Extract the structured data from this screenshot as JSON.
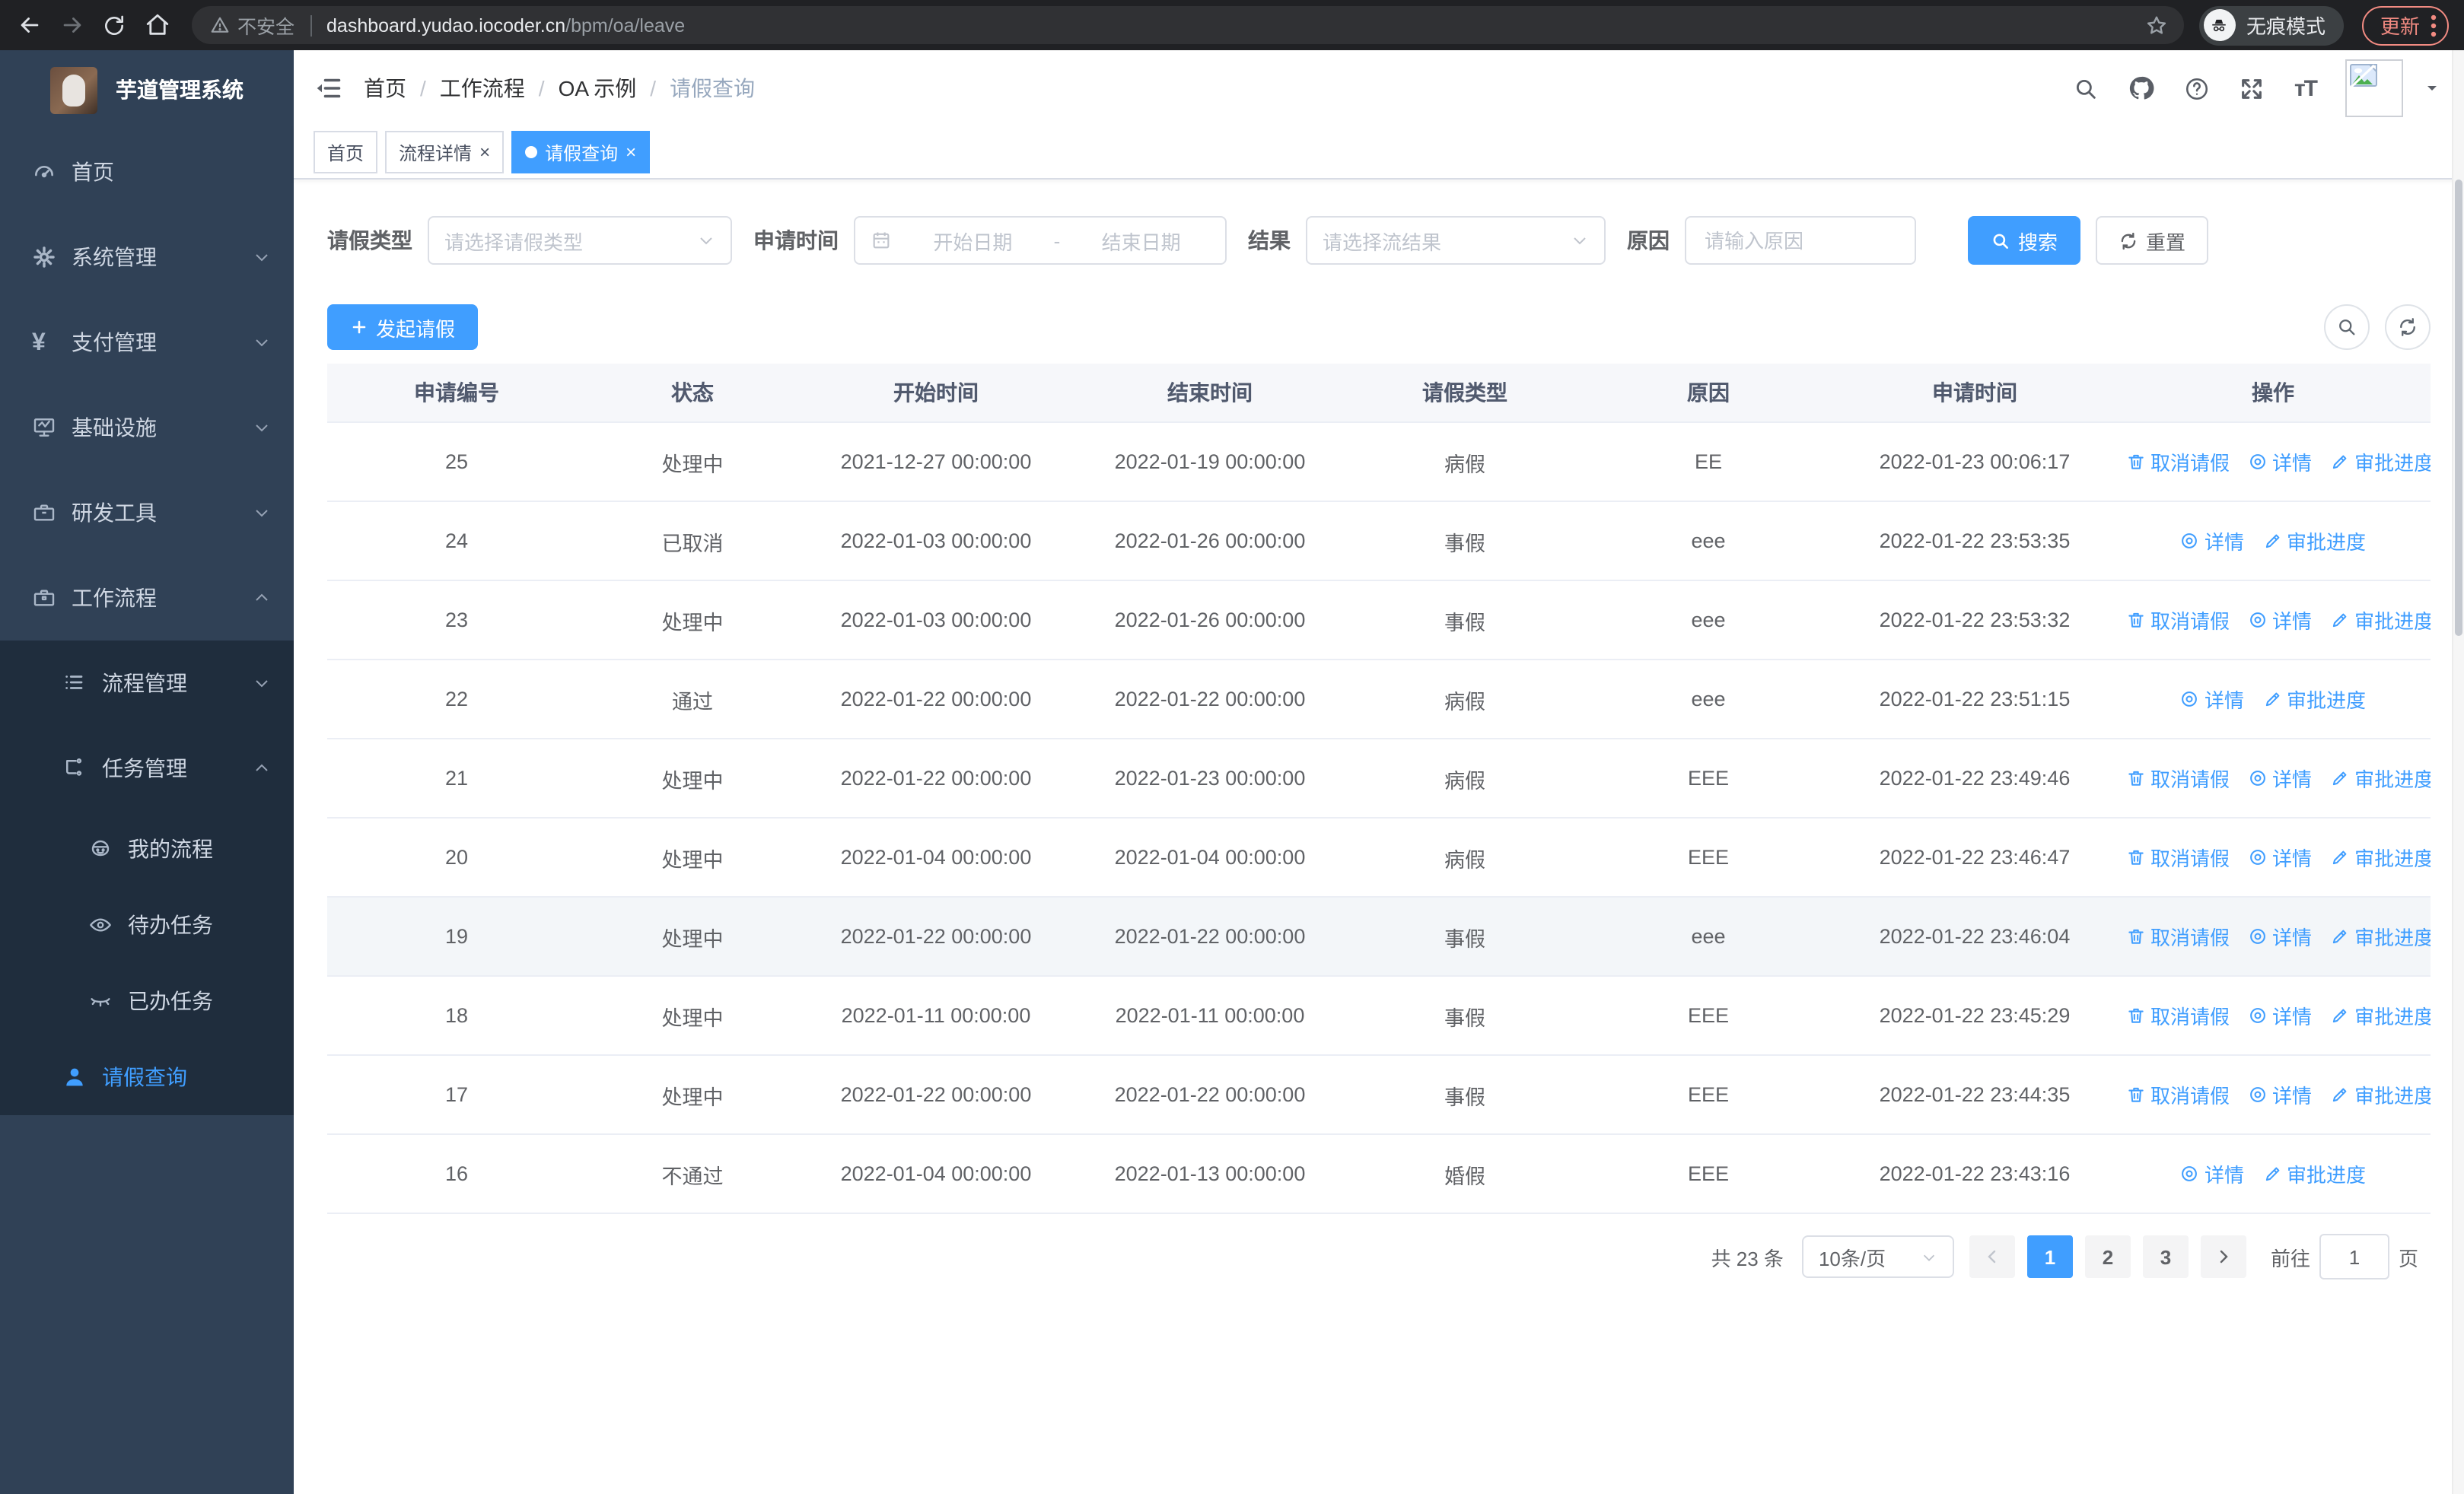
{
  "colors": {
    "accent": "#409eff",
    "sidebar_bg": "#304156",
    "sidebar_submenu_bg": "#1f2d3d",
    "chrome_bg": "#202124",
    "update_chip": "#f28b82"
  },
  "browser": {
    "security_label": "不安全",
    "url_host": "dashboard.yudao.iocoder.cn",
    "url_path": "/bpm/oa/leave",
    "incognito_label": "无痕模式",
    "update_label": "更新"
  },
  "sidebar": {
    "title": "芋道管理系统",
    "items": [
      {
        "label": "首页",
        "icon": "dashboard-icon"
      },
      {
        "label": "系统管理",
        "icon": "gear-icon",
        "chevron": "down"
      },
      {
        "label": "支付管理",
        "icon": "yen-icon",
        "chevron": "down"
      },
      {
        "label": "基础设施",
        "icon": "monitor-icon",
        "chevron": "down"
      },
      {
        "label": "研发工具",
        "icon": "toolbox-icon",
        "chevron": "down"
      },
      {
        "label": "工作流程",
        "icon": "briefcase-icon",
        "chevron": "up"
      },
      {
        "label": "流程管理",
        "icon": "list-icon",
        "chevron": "down"
      },
      {
        "label": "任务管理",
        "icon": "tree-icon",
        "chevron": "up"
      },
      {
        "label": "我的流程",
        "icon": "robot-icon"
      },
      {
        "label": "待办任务",
        "icon": "eye-open-icon"
      },
      {
        "label": "已办任务",
        "icon": "eye-closed-icon"
      },
      {
        "label": "请假查询",
        "icon": "user-icon",
        "active": true
      }
    ]
  },
  "navbar": {
    "breadcrumb": [
      {
        "label": "首页"
      },
      {
        "label": "工作流程"
      },
      {
        "label": "OA 示例"
      },
      {
        "label": "请假查询"
      }
    ]
  },
  "tabs": {
    "items": [
      {
        "label": "首页",
        "closable": false,
        "active": false
      },
      {
        "label": "流程详情",
        "closable": true,
        "active": false
      },
      {
        "label": "请假查询",
        "closable": true,
        "active": true
      }
    ]
  },
  "filters": {
    "leave_type_label": "请假类型",
    "leave_type_placeholder": "请选择请假类型",
    "apply_time_label": "申请时间",
    "date_start_placeholder": "开始日期",
    "date_separator": "-",
    "date_end_placeholder": "结束日期",
    "result_label": "结果",
    "result_placeholder": "请选择流结果",
    "reason_label": "原因",
    "reason_placeholder": "请输入原因",
    "search_button": "搜索",
    "reset_button": "重置"
  },
  "toolbar": {
    "create_button": "发起请假"
  },
  "table": {
    "columns": [
      "申请编号",
      "状态",
      "开始时间",
      "结束时间",
      "请假类型",
      "原因",
      "申请时间",
      "操作"
    ],
    "action_labels": {
      "cancel": "取消请假",
      "detail": "详情",
      "progress": "审批进度"
    },
    "rows": [
      {
        "id": "25",
        "status": "处理中",
        "start": "2021-12-27 00:00:00",
        "end": "2022-01-19 00:00:00",
        "type": "病假",
        "reason": "EE",
        "applied": "2022-01-23 00:06:17",
        "actions": [
          "cancel",
          "detail",
          "progress"
        ],
        "hover": false
      },
      {
        "id": "24",
        "status": "已取消",
        "start": "2022-01-03 00:00:00",
        "end": "2022-01-26 00:00:00",
        "type": "事假",
        "reason": "eee",
        "applied": "2022-01-22 23:53:35",
        "actions": [
          "detail",
          "progress"
        ],
        "hover": false
      },
      {
        "id": "23",
        "status": "处理中",
        "start": "2022-01-03 00:00:00",
        "end": "2022-01-26 00:00:00",
        "type": "事假",
        "reason": "eee",
        "applied": "2022-01-22 23:53:32",
        "actions": [
          "cancel",
          "detail",
          "progress"
        ],
        "hover": false
      },
      {
        "id": "22",
        "status": "通过",
        "start": "2022-01-22 00:00:00",
        "end": "2022-01-22 00:00:00",
        "type": "病假",
        "reason": "eee",
        "applied": "2022-01-22 23:51:15",
        "actions": [
          "detail",
          "progress"
        ],
        "hover": false
      },
      {
        "id": "21",
        "status": "处理中",
        "start": "2022-01-22 00:00:00",
        "end": "2022-01-23 00:00:00",
        "type": "病假",
        "reason": "EEE",
        "applied": "2022-01-22 23:49:46",
        "actions": [
          "cancel",
          "detail",
          "progress"
        ],
        "hover": false
      },
      {
        "id": "20",
        "status": "处理中",
        "start": "2022-01-04 00:00:00",
        "end": "2022-01-04 00:00:00",
        "type": "病假",
        "reason": "EEE",
        "applied": "2022-01-22 23:46:47",
        "actions": [
          "cancel",
          "detail",
          "progress"
        ],
        "hover": false
      },
      {
        "id": "19",
        "status": "处理中",
        "start": "2022-01-22 00:00:00",
        "end": "2022-01-22 00:00:00",
        "type": "事假",
        "reason": "eee",
        "applied": "2022-01-22 23:46:04",
        "actions": [
          "cancel",
          "detail",
          "progress"
        ],
        "hover": true
      },
      {
        "id": "18",
        "status": "处理中",
        "start": "2022-01-11 00:00:00",
        "end": "2022-01-11 00:00:00",
        "type": "事假",
        "reason": "EEE",
        "applied": "2022-01-22 23:45:29",
        "actions": [
          "cancel",
          "detail",
          "progress"
        ],
        "hover": false
      },
      {
        "id": "17",
        "status": "处理中",
        "start": "2022-01-22 00:00:00",
        "end": "2022-01-22 00:00:00",
        "type": "事假",
        "reason": "EEE",
        "applied": "2022-01-22 23:44:35",
        "actions": [
          "cancel",
          "detail",
          "progress"
        ],
        "hover": false
      },
      {
        "id": "16",
        "status": "不通过",
        "start": "2022-01-04 00:00:00",
        "end": "2022-01-13 00:00:00",
        "type": "婚假",
        "reason": "EEE",
        "applied": "2022-01-22 23:43:16",
        "actions": [
          "detail",
          "progress"
        ],
        "hover": false
      }
    ]
  },
  "pagination": {
    "total_text": "共 23 条",
    "page_size": "10条/页",
    "pages": [
      "1",
      "2",
      "3"
    ],
    "active_page": "1",
    "goto_label": "前往",
    "goto_value": "1",
    "goto_suffix": "页"
  }
}
